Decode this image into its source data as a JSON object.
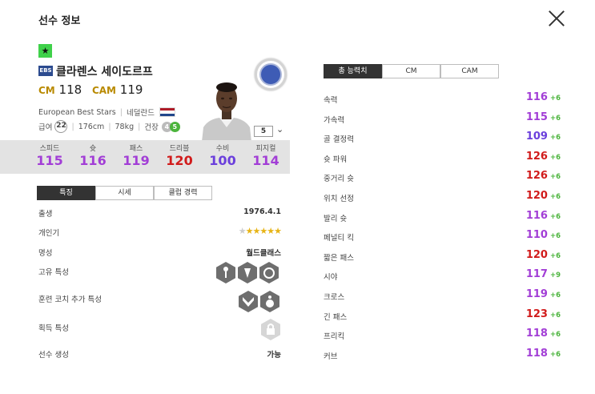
{
  "header": {
    "title": "선수 정보"
  },
  "player": {
    "season_badge": "EBS",
    "name": "클라렌스 세이도르프",
    "positions": [
      {
        "pos": "CM",
        "ovr": "118"
      },
      {
        "pos": "CAM",
        "ovr": "119"
      }
    ],
    "team": "European Best Stars",
    "nation": "네덜란드",
    "pay_label": "급여",
    "pay": "22",
    "height": "176cm",
    "weight": "78kg",
    "build": "건장",
    "foot_left": "4",
    "foot_right": "5",
    "enhance_level": "5"
  },
  "colors": {
    "purple": "#a23ed6",
    "red": "#d11b1b",
    "violet": "#7a3fdc",
    "green": "#4bb43c",
    "dutch_red": "#ae1c28",
    "dutch_blue": "#21468b"
  },
  "summary_stats": [
    {
      "label": "스피드",
      "value": "115",
      "color": "#a23ed6"
    },
    {
      "label": "슛",
      "value": "116",
      "color": "#a23ed6"
    },
    {
      "label": "패스",
      "value": "119",
      "color": "#a23ed6"
    },
    {
      "label": "드리블",
      "value": "120",
      "color": "#d11b1b"
    },
    {
      "label": "수비",
      "value": "100",
      "color": "#6b3fdc"
    },
    {
      "label": "피지컬",
      "value": "114",
      "color": "#a23ed6"
    }
  ],
  "left_tabs": [
    {
      "label": "특징",
      "active": true
    },
    {
      "label": "시세",
      "active": false
    },
    {
      "label": "클럽 경력",
      "active": false
    }
  ],
  "details": {
    "birth_label": "출생",
    "birth": "1976.4.1",
    "popularity_label": "개인기",
    "popularity_stars": 5,
    "fame_label": "명성",
    "fame": "월드클래스",
    "traits_label": "고유 특성",
    "coach_traits_label": "훈련 코치 추가 특성",
    "acquire_traits_label": "획득 특성",
    "create_label": "선수 생성",
    "create": "가능"
  },
  "icons": {
    "close": "close-icon",
    "trait": "trait-hex-icon",
    "lock": "lock-icon",
    "star": "star-icon"
  },
  "right_tabs": [
    {
      "label": "총 능력치",
      "active": true
    },
    {
      "label": "CM",
      "active": false
    },
    {
      "label": "CAM",
      "active": false
    }
  ],
  "attributes": [
    {
      "label": "속력",
      "value": "116",
      "bonus": "+6",
      "color": "#a23ed6"
    },
    {
      "label": "가속력",
      "value": "115",
      "bonus": "+6",
      "color": "#a23ed6"
    },
    {
      "label": "골 결정력",
      "value": "109",
      "bonus": "+6",
      "color": "#6b3fdc"
    },
    {
      "label": "슛 파워",
      "value": "126",
      "bonus": "+6",
      "color": "#d11b1b"
    },
    {
      "label": "중거리 슛",
      "value": "126",
      "bonus": "+6",
      "color": "#d11b1b"
    },
    {
      "label": "위치 선정",
      "value": "120",
      "bonus": "+6",
      "color": "#d11b1b"
    },
    {
      "label": "발리 슛",
      "value": "116",
      "bonus": "+6",
      "color": "#a23ed6"
    },
    {
      "label": "페널티 킥",
      "value": "110",
      "bonus": "+6",
      "color": "#a23ed6"
    },
    {
      "label": "짧은 패스",
      "value": "120",
      "bonus": "+6",
      "color": "#d11b1b"
    },
    {
      "label": "시야",
      "value": "117",
      "bonus": "+9",
      "color": "#a23ed6"
    },
    {
      "label": "크로스",
      "value": "119",
      "bonus": "+6",
      "color": "#a23ed6"
    },
    {
      "label": "긴 패스",
      "value": "123",
      "bonus": "+6",
      "color": "#d11b1b"
    },
    {
      "label": "프리킥",
      "value": "118",
      "bonus": "+6",
      "color": "#a23ed6"
    },
    {
      "label": "커브",
      "value": "118",
      "bonus": "+6",
      "color": "#a23ed6"
    }
  ]
}
